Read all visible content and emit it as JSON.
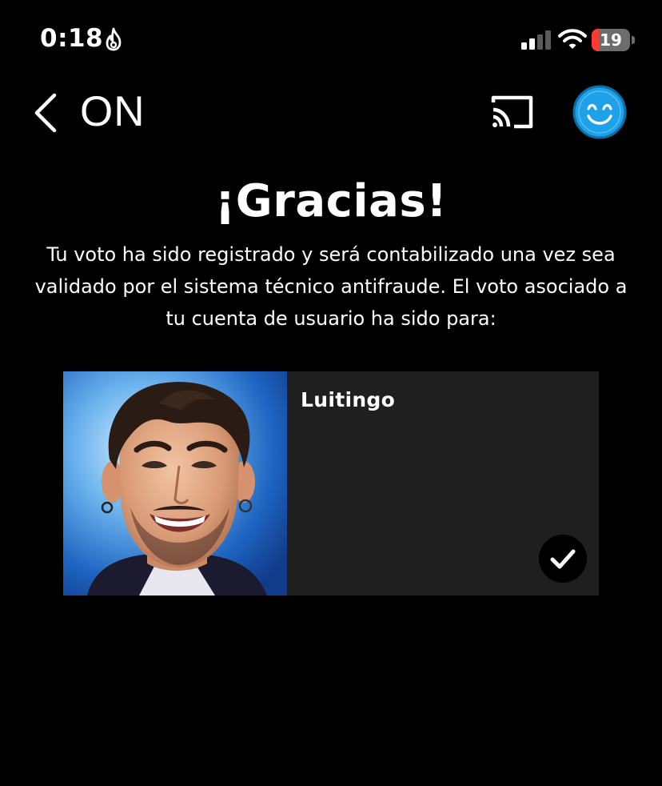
{
  "status_bar": {
    "time": "0:18",
    "battery_level": "19",
    "battery_fraction": 0.19,
    "battery_color": "#ff3b30",
    "icons": [
      "flame-icon",
      "signal-icon",
      "wifi-icon",
      "battery-icon"
    ]
  },
  "nav": {
    "title": "ON",
    "icons": [
      "chevron-left-icon",
      "cast-icon",
      "smiley-avatar-icon"
    ],
    "avatar_color": "#1da1e8"
  },
  "content": {
    "heading": "¡Gracias!",
    "message": "Tu voto ha sido registrado y será contabilizado una vez sea validado por el sistema técnico antifraude. El voto asociado a tu cuenta de usuario ha sido para:"
  },
  "candidate": {
    "name": "Luitingo",
    "selected": true,
    "card_background": "#1f1f1f"
  }
}
